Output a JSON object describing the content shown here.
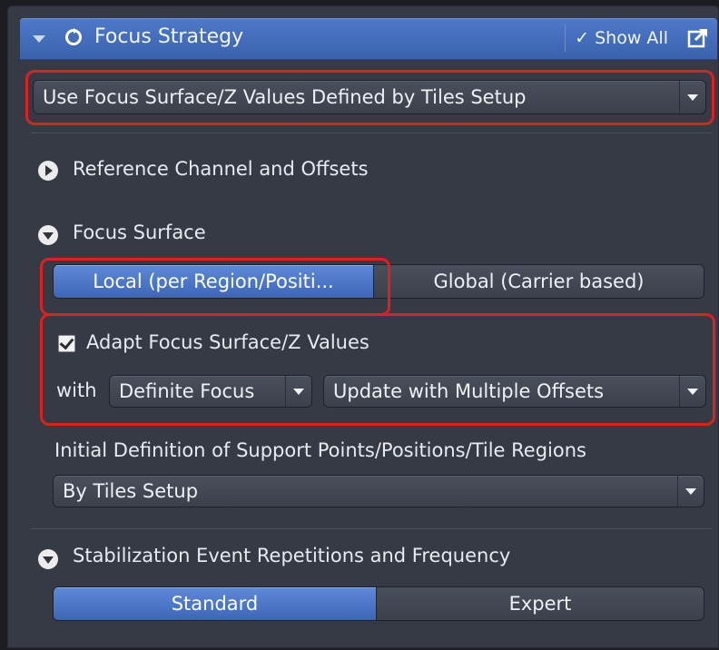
{
  "header": {
    "title": "Focus Strategy",
    "show_all_label": "Show All",
    "show_all_check": "✓"
  },
  "strategy_select": {
    "value": "Use Focus Surface/Z Values Defined by Tiles Setup"
  },
  "sections": {
    "reference": {
      "label": "Reference Channel and Offsets"
    },
    "focus_surface": {
      "label": "Focus Surface",
      "local_label": "Local (per Region/Positi...",
      "global_label": "Global (Carrier based)",
      "adapt_label": "Adapt Focus Surface/Z Values",
      "adapt_checked": true,
      "with_label": "with",
      "method_select": "Definite Focus",
      "update_select": "Update with Multiple Offsets",
      "initial_definition_label": "Initial Definition of Support Points/Positions/Tile Regions",
      "initial_definition_select": "By Tiles Setup"
    },
    "stabilization": {
      "label": "Stabilization Event Repetitions and Frequency",
      "standard_label": "Standard",
      "expert_label": "Expert"
    }
  },
  "colors": {
    "accent": "#4a74c2",
    "highlight": "#e01f1f",
    "panel": "#363a45"
  }
}
